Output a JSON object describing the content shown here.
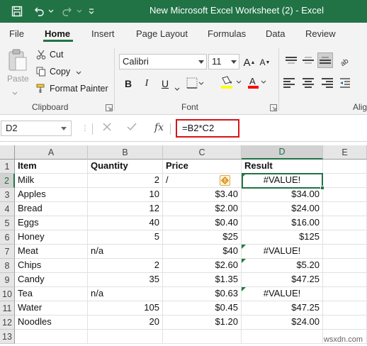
{
  "window": {
    "title": "New Microsoft Excel Worksheet (2)  -  Excel"
  },
  "tabs": [
    "File",
    "Home",
    "Insert",
    "Page Layout",
    "Formulas",
    "Data",
    "Review"
  ],
  "ribbon": {
    "clipboard": {
      "paste_label": "Paste",
      "cut_label": "Cut",
      "copy_label": "Copy",
      "format_painter_label": "Format Painter",
      "group_label": "Clipboard"
    },
    "font": {
      "font_name": "Calibri",
      "font_size": "11",
      "bold": "B",
      "italic": "I",
      "underline": "U",
      "font_grow": "A",
      "font_shrink": "A",
      "highlight_color": "#ffff00",
      "font_color": "#ff0000",
      "group_label": "Font"
    },
    "alignment": {
      "group_label_partial": "Alig"
    }
  },
  "formula_bar": {
    "name_box": "D2",
    "fx_label": "fx",
    "formula": "=B2*C2"
  },
  "sheet": {
    "columns": [
      "A",
      "B",
      "C",
      "D",
      "E"
    ],
    "selected_column": "D",
    "selected_row": "2",
    "row_numbers": [
      "1",
      "2",
      "3",
      "4",
      "5",
      "6",
      "7",
      "8",
      "9",
      "10",
      "11",
      "12",
      "13"
    ],
    "header": {
      "a": "Item",
      "b": "Quantity",
      "c": "Price",
      "d": "Result"
    },
    "rows": [
      {
        "a": "Milk",
        "b": "2",
        "c": "/",
        "d": "#VALUE!"
      },
      {
        "a": "Apples",
        "b": "10",
        "c": "$3.40",
        "d": "$34.00"
      },
      {
        "a": "Bread",
        "b": "12",
        "c": "$2.00",
        "d": "$24.00"
      },
      {
        "a": "Eggs",
        "b": "40",
        "c": "$0.40",
        "d": "$16.00"
      },
      {
        "a": "Honey",
        "b": "5",
        "c": "$25",
        "d": "$125"
      },
      {
        "a": "Meat",
        "b": "n/a",
        "c": "$40",
        "d": "#VALUE!"
      },
      {
        "a": "Chips",
        "b": "2",
        "c": "$2.60",
        "d": "$5.20"
      },
      {
        "a": "Candy",
        "b": "35",
        "c": "$1.35",
        "d": "$47.25"
      },
      {
        "a": "Tea",
        "b": "n/a",
        "c": "$0.63",
        "d": "#VALUE!"
      },
      {
        "a": "Water",
        "b": "105",
        "c": "$0.45",
        "d": "$47.25"
      },
      {
        "a": "Noodles",
        "b": "20",
        "c": "$1.20",
        "d": "$24.00"
      }
    ]
  },
  "watermark": "wsxdn.com",
  "colors": {
    "excel_green": "#217346",
    "highlight_red": "#d8131a"
  }
}
